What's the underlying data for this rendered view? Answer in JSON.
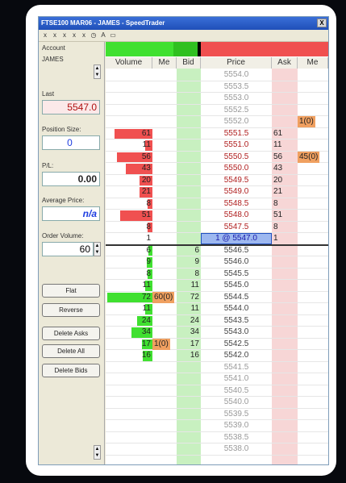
{
  "window": {
    "title": "FTSE100 MAR06 - JAMES - SpeedTrader",
    "close_label": "X"
  },
  "toolbar": {
    "icons": [
      "x",
      "x",
      "x",
      "x",
      "x",
      "◷",
      "A",
      "▭"
    ]
  },
  "left_panel": {
    "account_label": "Account",
    "account_value": "JAMES",
    "last_label": "Last",
    "last_value": "5547.0",
    "position_label": "Position Size:",
    "position_value": "0",
    "pl_label": "P/L:",
    "pl_value": "0.00",
    "avg_label": "Average Price:",
    "avg_value": "n/a",
    "order_label": "Order Volume:",
    "order_value": "60",
    "buttons": [
      "Flat",
      "Reverse",
      "Delete Asks",
      "Delete All",
      "Delete Bids"
    ]
  },
  "ladder": {
    "headers": [
      "Volume",
      "Me",
      "Bid",
      "Price",
      "Ask",
      "Me"
    ],
    "rows": [
      {
        "price": "5554.0"
      },
      {
        "price": "5553.5"
      },
      {
        "price": "5553.0"
      },
      {
        "price": "5552.5"
      },
      {
        "price": "5552.0",
        "ask_me": "1(0)"
      },
      {
        "price": "5551.5",
        "volume": "61",
        "ask": "61"
      },
      {
        "price": "5551.0",
        "volume": "11",
        "ask": "11"
      },
      {
        "price": "5550.5",
        "volume": "56",
        "ask": "56",
        "ask_me": "45(0)"
      },
      {
        "price": "5550.0",
        "volume": "43",
        "ask": "43"
      },
      {
        "price": "5549.5",
        "volume": "20",
        "ask": "20"
      },
      {
        "price": "5549.0",
        "volume": "21",
        "ask": "21"
      },
      {
        "price": "5548.5",
        "volume": "8",
        "ask": "8"
      },
      {
        "price": "5548.0",
        "volume": "51",
        "ask": "51"
      },
      {
        "price": "5547.5",
        "volume": "8",
        "ask": "8"
      },
      {
        "price": "1 @ 5547.0",
        "volume": "1",
        "ask": "1",
        "last": true
      },
      {
        "price": "5546.5",
        "volume": "6",
        "bid": "6"
      },
      {
        "price": "5546.0",
        "volume": "9",
        "bid": "9"
      },
      {
        "price": "5545.5",
        "volume": "8",
        "bid": "8"
      },
      {
        "price": "5545.0",
        "volume": "11",
        "bid": "11"
      },
      {
        "price": "5544.5",
        "volume": "72",
        "bid": "72",
        "bid_me": "60(0)"
      },
      {
        "price": "5544.0",
        "volume": "11",
        "bid": "11"
      },
      {
        "price": "5543.5",
        "volume": "24",
        "bid": "24"
      },
      {
        "price": "5543.0",
        "volume": "34",
        "bid": "34"
      },
      {
        "price": "5542.5",
        "volume": "17",
        "bid": "17",
        "bid_me": "1(0)"
      },
      {
        "price": "5542.0",
        "volume": "16",
        "bid": "16"
      },
      {
        "price": "5541.5"
      },
      {
        "price": "5541.0"
      },
      {
        "price": "5540.5"
      },
      {
        "price": "5540.0"
      },
      {
        "price": "5539.5"
      },
      {
        "price": "5539.0"
      },
      {
        "price": "5538.5"
      },
      {
        "price": "5538.0"
      }
    ]
  },
  "colors": {
    "ask": "#f05050",
    "bid": "#40e030",
    "ask_bg": "#f7d6d6",
    "bid_bg": "#c8f0c0",
    "me_order": "#f0a060",
    "last_bg": "#9db8f0"
  }
}
